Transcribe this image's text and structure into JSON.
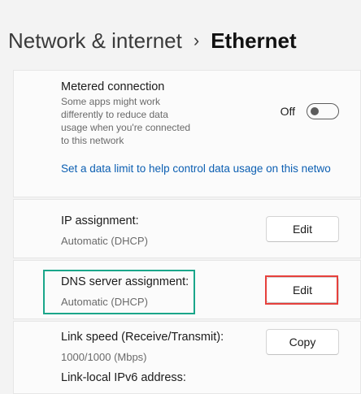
{
  "breadcrumb": {
    "parent": "Network & internet",
    "separator": "›",
    "current": "Ethernet"
  },
  "metered": {
    "title": "Metered connection",
    "description": [
      "Some apps might work",
      "differently to reduce data",
      "usage when you're connected",
      "to this network"
    ],
    "toggle_label": "Off",
    "toggle_state": "off",
    "data_limit_link": "Set a data limit to help control data usage on this netwo"
  },
  "ip_assignment": {
    "title": "IP assignment:",
    "value": "Automatic (DHCP)",
    "button_label": "Edit"
  },
  "dns_assignment": {
    "title": "DNS server assignment:",
    "value": "Automatic (DHCP)",
    "button_label": "Edit"
  },
  "link_speed": {
    "title": "Link speed (Receive/Transmit):",
    "value": "1000/1000 (Mbps)",
    "button_label": "Copy"
  },
  "ipv6": {
    "title": "Link-local IPv6 address:"
  },
  "colors": {
    "link": "#0c5fb2",
    "highlight_green": "#1aa68a",
    "highlight_red": "#e6403c"
  }
}
